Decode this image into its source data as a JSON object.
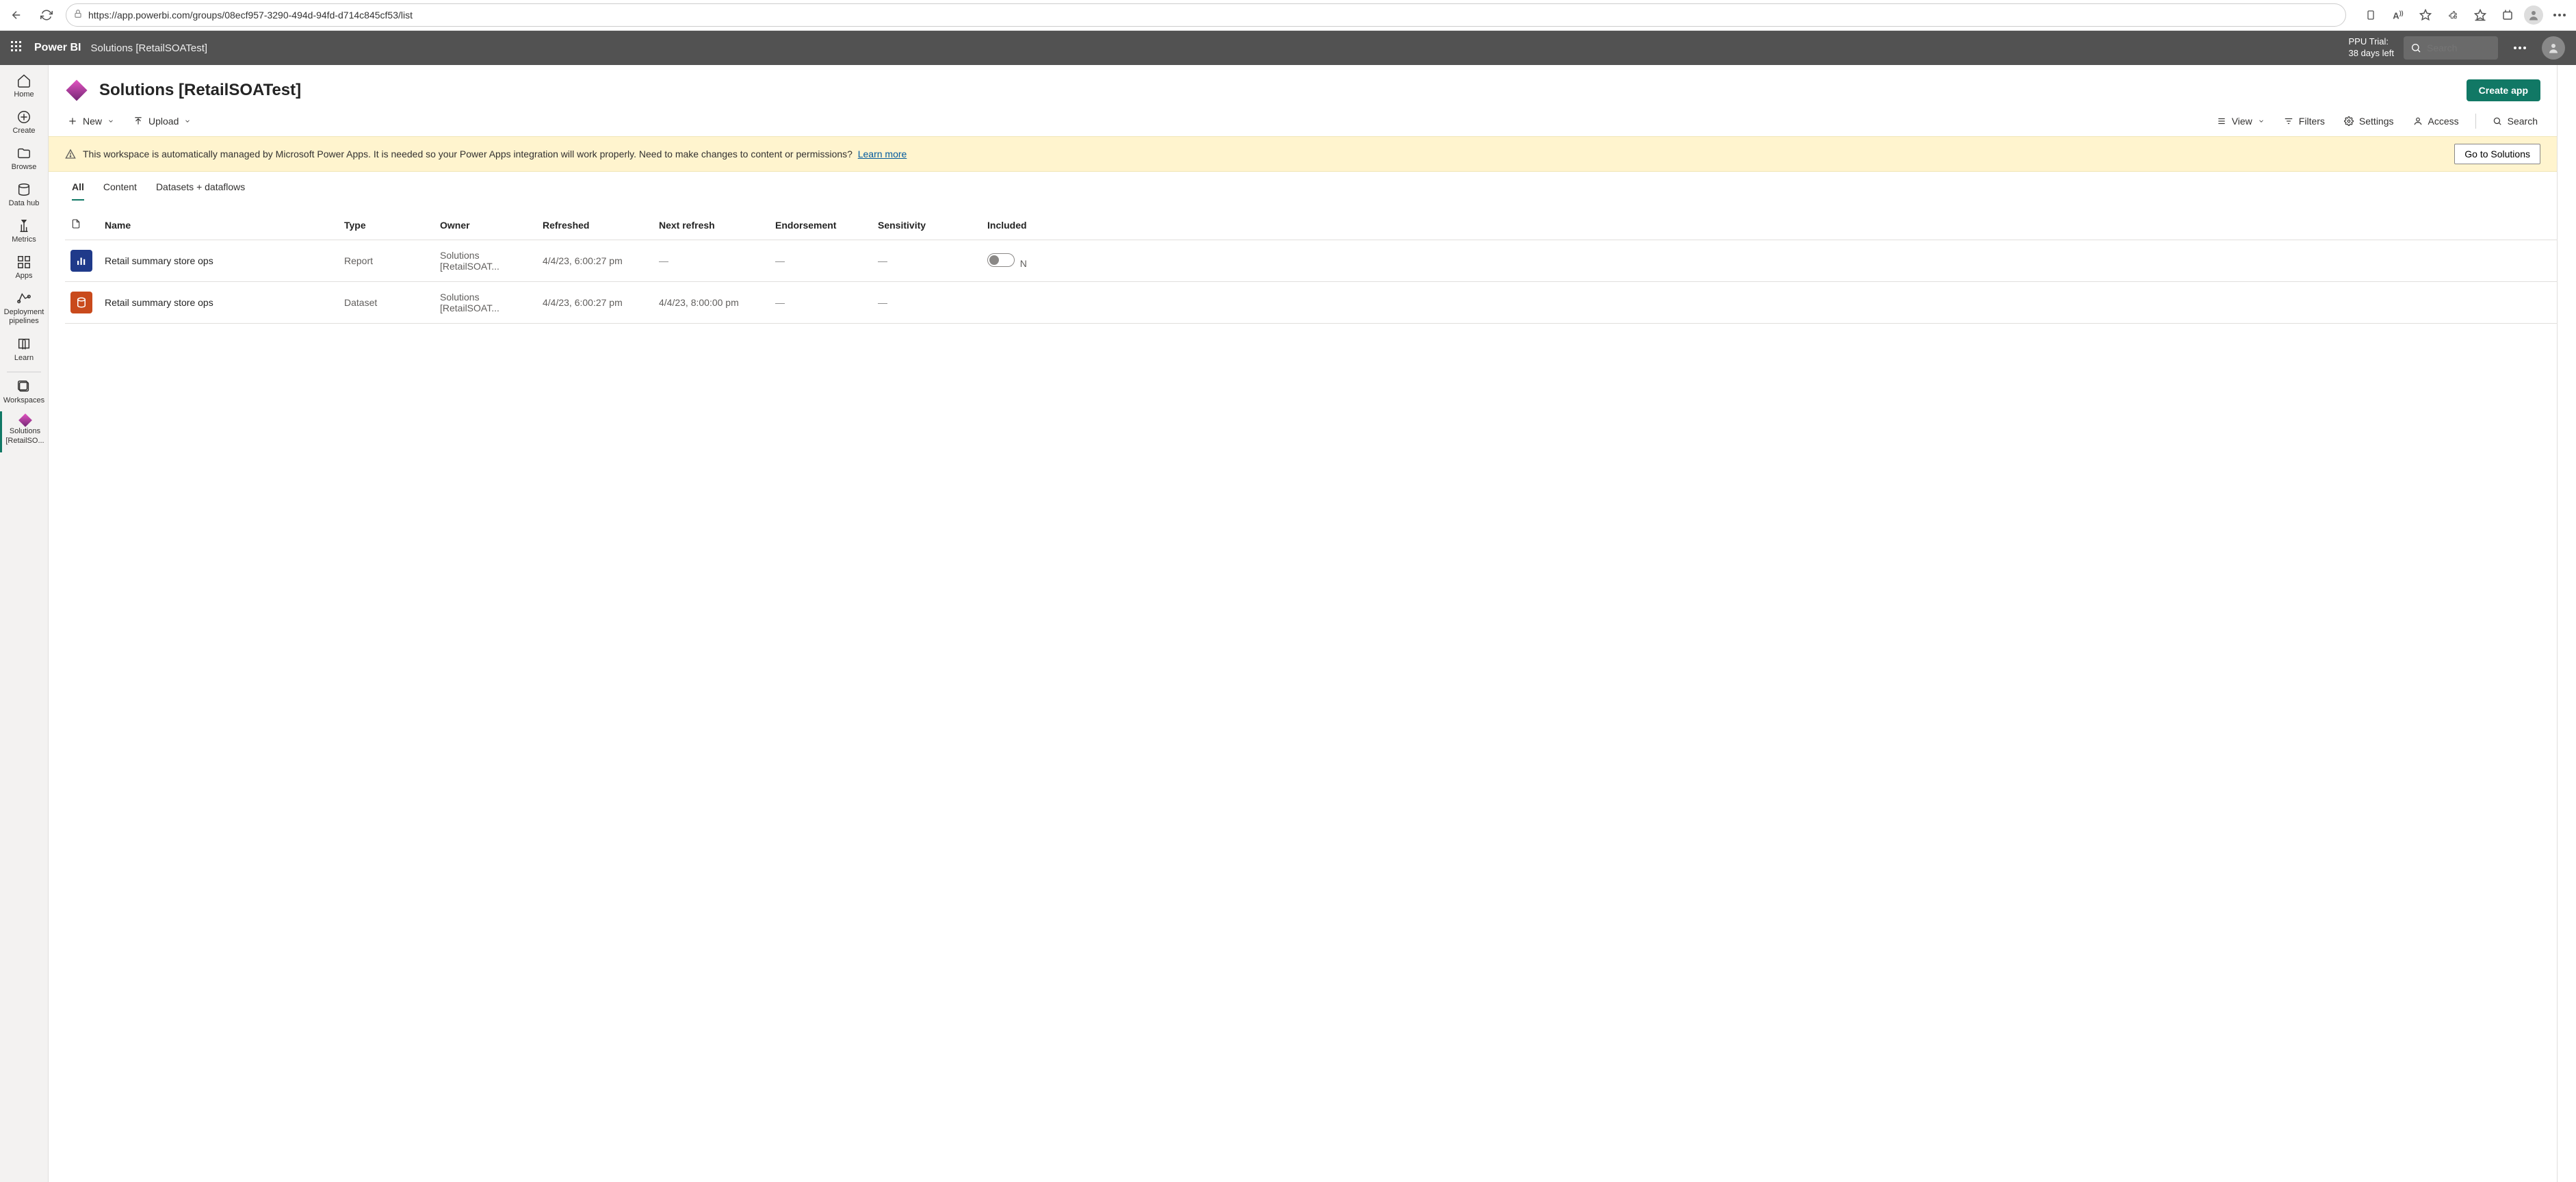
{
  "browser": {
    "url": "https://app.powerbi.com/groups/08ecf957-3290-494d-94fd-d714c845cf53/list"
  },
  "topbar": {
    "brand": "Power BI",
    "crumb": "Solutions [RetailSOATest]",
    "trial_line1": "PPU Trial:",
    "trial_line2": "38 days left",
    "search_placeholder": "Search"
  },
  "leftnav": {
    "home": "Home",
    "create": "Create",
    "browse": "Browse",
    "datahub": "Data hub",
    "metrics": "Metrics",
    "apps": "Apps",
    "deploy": "Deployment pipelines",
    "learn": "Learn",
    "workspaces": "Workspaces",
    "current_ws_l1": "Solutions",
    "current_ws_l2": "[RetailSO..."
  },
  "header": {
    "title": "Solutions [RetailSOATest]",
    "create_app": "Create app"
  },
  "toolbar": {
    "new": "New",
    "upload": "Upload",
    "view": "View",
    "filters": "Filters",
    "settings": "Settings",
    "access": "Access",
    "search": "Search"
  },
  "banner": {
    "text": "This workspace is automatically managed by Microsoft Power Apps. It is needed so your Power Apps integration will work properly. Need to make changes to content or permissions?",
    "learn_more": "Learn more",
    "go_solutions": "Go to Solutions"
  },
  "tabs": {
    "all": "All",
    "content": "Content",
    "datasets": "Datasets + dataflows"
  },
  "columns": {
    "name": "Name",
    "type": "Type",
    "owner": "Owner",
    "refreshed": "Refreshed",
    "next_refresh": "Next refresh",
    "endorsement": "Endorsement",
    "sensitivity": "Sensitivity",
    "included": "Included"
  },
  "rows": [
    {
      "name": "Retail summary store ops",
      "type": "Report",
      "icon_class": "type-report",
      "owner": "Solutions [RetailSOAT...",
      "refreshed": "4/4/23, 6:00:27 pm",
      "next_refresh": "—",
      "endorsement": "—",
      "sensitivity": "—",
      "included_toggle": true,
      "included_text": "N"
    },
    {
      "name": "Retail summary store ops",
      "type": "Dataset",
      "icon_class": "type-dataset",
      "owner": "Solutions [RetailSOAT...",
      "refreshed": "4/4/23, 6:00:27 pm",
      "next_refresh": "4/4/23, 8:00:00 pm",
      "endorsement": "—",
      "sensitivity": "—",
      "included_toggle": false,
      "included_text": ""
    }
  ]
}
